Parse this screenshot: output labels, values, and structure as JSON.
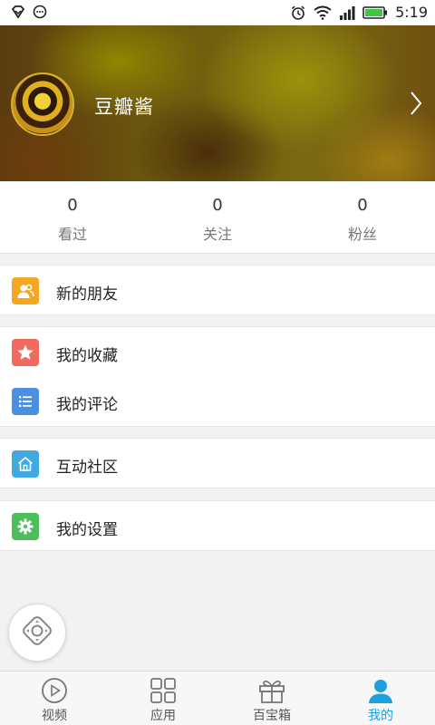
{
  "status_bar": {
    "time": "5:19",
    "icons": [
      "notification-icon",
      "chat-icon",
      "alarm-icon",
      "wifi-icon",
      "signal-icon",
      "battery-icon"
    ]
  },
  "profile": {
    "username": "豆瓣酱"
  },
  "stats": [
    {
      "value": "0",
      "label": "看过"
    },
    {
      "value": "0",
      "label": "关注"
    },
    {
      "value": "0",
      "label": "粉丝"
    }
  ],
  "menu": [
    {
      "label": "新的朋友",
      "icon": "friends-icon",
      "color": "#f5a623"
    },
    {
      "label": "我的收藏",
      "icon": "star-icon",
      "color": "#f06a5e"
    },
    {
      "label": "我的评论",
      "icon": "list-icon",
      "color": "#4a90e2"
    },
    {
      "label": "互动社区",
      "icon": "home-icon",
      "color": "#3fa9e0"
    },
    {
      "label": "我的设置",
      "icon": "gear-icon",
      "color": "#4cbf5a"
    }
  ],
  "tabs": [
    {
      "label": "视频",
      "icon": "play-icon",
      "active": false
    },
    {
      "label": "应用",
      "icon": "apps-icon",
      "active": false
    },
    {
      "label": "百宝箱",
      "icon": "gift-icon",
      "active": false
    },
    {
      "label": "我的",
      "icon": "person-icon",
      "active": true
    }
  ],
  "colors": {
    "accent": "#1ea0e0",
    "background": "#f2f2f2"
  }
}
